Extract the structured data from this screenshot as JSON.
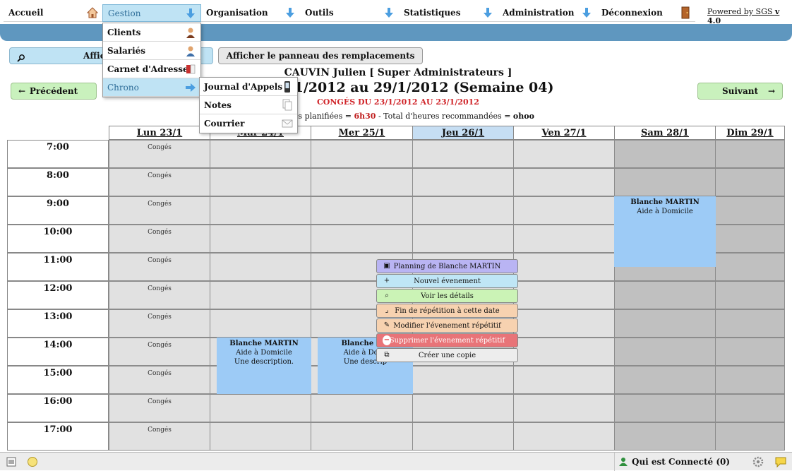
{
  "menu": {
    "items": [
      {
        "label": "Accueil",
        "icon": "home-icon"
      },
      {
        "label": "Gestion",
        "icon": "down-arrow-icon"
      },
      {
        "label": "Organisation",
        "icon": "down-arrow-icon"
      },
      {
        "label": "Outils",
        "icon": "down-arrow-icon"
      },
      {
        "label": "Statistiques",
        "icon": "down-arrow-icon"
      },
      {
        "label": "Administration",
        "icon": "down-arrow-icon"
      },
      {
        "label": "Déconnexion",
        "icon": "door-icon"
      }
    ],
    "powered_prefix": "Powered by SGS ",
    "powered_version": "v 4.0"
  },
  "gestion_menu": {
    "items": [
      {
        "label": "Clients",
        "icon": "person-icon"
      },
      {
        "label": "Salariés",
        "icon": "person-icon"
      },
      {
        "label": "Carnet d'Adresse",
        "icon": "book-icon"
      },
      {
        "label": "Chrono",
        "icon": "right-arrow-icon"
      }
    ]
  },
  "chrono_menu": {
    "items": [
      {
        "label": "Journal d'Appels",
        "icon": "phone-icon"
      },
      {
        "label": "Notes",
        "icon": "notes-icon"
      },
      {
        "label": "Courrier",
        "icon": "mail-icon"
      }
    ]
  },
  "toolbar": {
    "afficher_label": "Afficher la l",
    "remplacements_label": "Afficher le panneau des remplacements",
    "prev_label": "Précédent",
    "next_label": "Suivant"
  },
  "header": {
    "user": "CAUVIN Julien [ Super Administrateurs ]",
    "week": "du 23/1/2012 au 29/1/2012 (Semaine 04)",
    "conges": "CONGÉS DU 23/1/2012 AU 23/1/2012",
    "hours_prefix": "eures planifiées = ",
    "planned": "6h30",
    "hours_mid": " - Total d'heures recommandées = ",
    "recommended": "ohoo"
  },
  "calendar": {
    "days": [
      {
        "label": "Lun 23/1",
        "today": false,
        "weekend": false
      },
      {
        "label": "Mar 24/1",
        "today": false,
        "weekend": false
      },
      {
        "label": "Mer 25/1",
        "today": false,
        "weekend": false
      },
      {
        "label": "Jeu 26/1",
        "today": true,
        "weekend": false
      },
      {
        "label": "Ven 27/1",
        "today": false,
        "weekend": false
      },
      {
        "label": "Sam 28/1",
        "today": false,
        "weekend": true
      },
      {
        "label": "Dim 29/1",
        "today": false,
        "weekend": true
      }
    ],
    "hours": [
      "7:00",
      "8:00",
      "9:00",
      "10:00",
      "11:00",
      "12:00",
      "13:00",
      "14:00",
      "15:00",
      "16:00",
      "17:00"
    ],
    "conges_label": "Congés",
    "events": [
      {
        "day": 1,
        "start": "14:00",
        "end": "16:00",
        "name": "Blanche MARTIN",
        "service": "Aide à Domicile",
        "desc": "Une description."
      },
      {
        "day": 2,
        "start": "14:00",
        "end": "16:00",
        "name": "Blanche MA",
        "service": "Aide à Domi",
        "desc": "Une descrip"
      },
      {
        "day": 5,
        "start": "9:00",
        "end": "11:30",
        "name": "Blanche MARTIN",
        "service": "Aide à Domicile",
        "desc": ""
      }
    ]
  },
  "context_menu": {
    "items": [
      {
        "label": "Planning de Blanche MARTIN",
        "icon": "calendar-icon",
        "color": "#b9b4f3"
      },
      {
        "label": "Nouvel évenement",
        "icon": "plus-icon",
        "color": "#bfe6f6"
      },
      {
        "label": "Voir les détails",
        "icon": "magnifier-icon",
        "color": "#cbf3b6"
      },
      {
        "label": "Fin de répétition à cette date",
        "icon": "corner-icon",
        "color": "#f7d2b0"
      },
      {
        "label": "Modifier l'évenement répétitif",
        "icon": "pencil-icon",
        "color": "#f7d2b0"
      },
      {
        "label": "Supprimer l'évenement répétitif",
        "icon": "minus-icon",
        "color": "#e87478"
      },
      {
        "label": "Créer une copie",
        "icon": "copy-icon",
        "color": "#ededed"
      }
    ]
  },
  "bottom": {
    "who_label": "Qui est Connecté (0)"
  },
  "colors": {
    "accent_blue": "#5f97bf",
    "active_blue": "#bfe3f4",
    "nav_green": "#c9f1bd",
    "event_blue": "#9dcbf6",
    "conges_red": "#d0252a"
  }
}
